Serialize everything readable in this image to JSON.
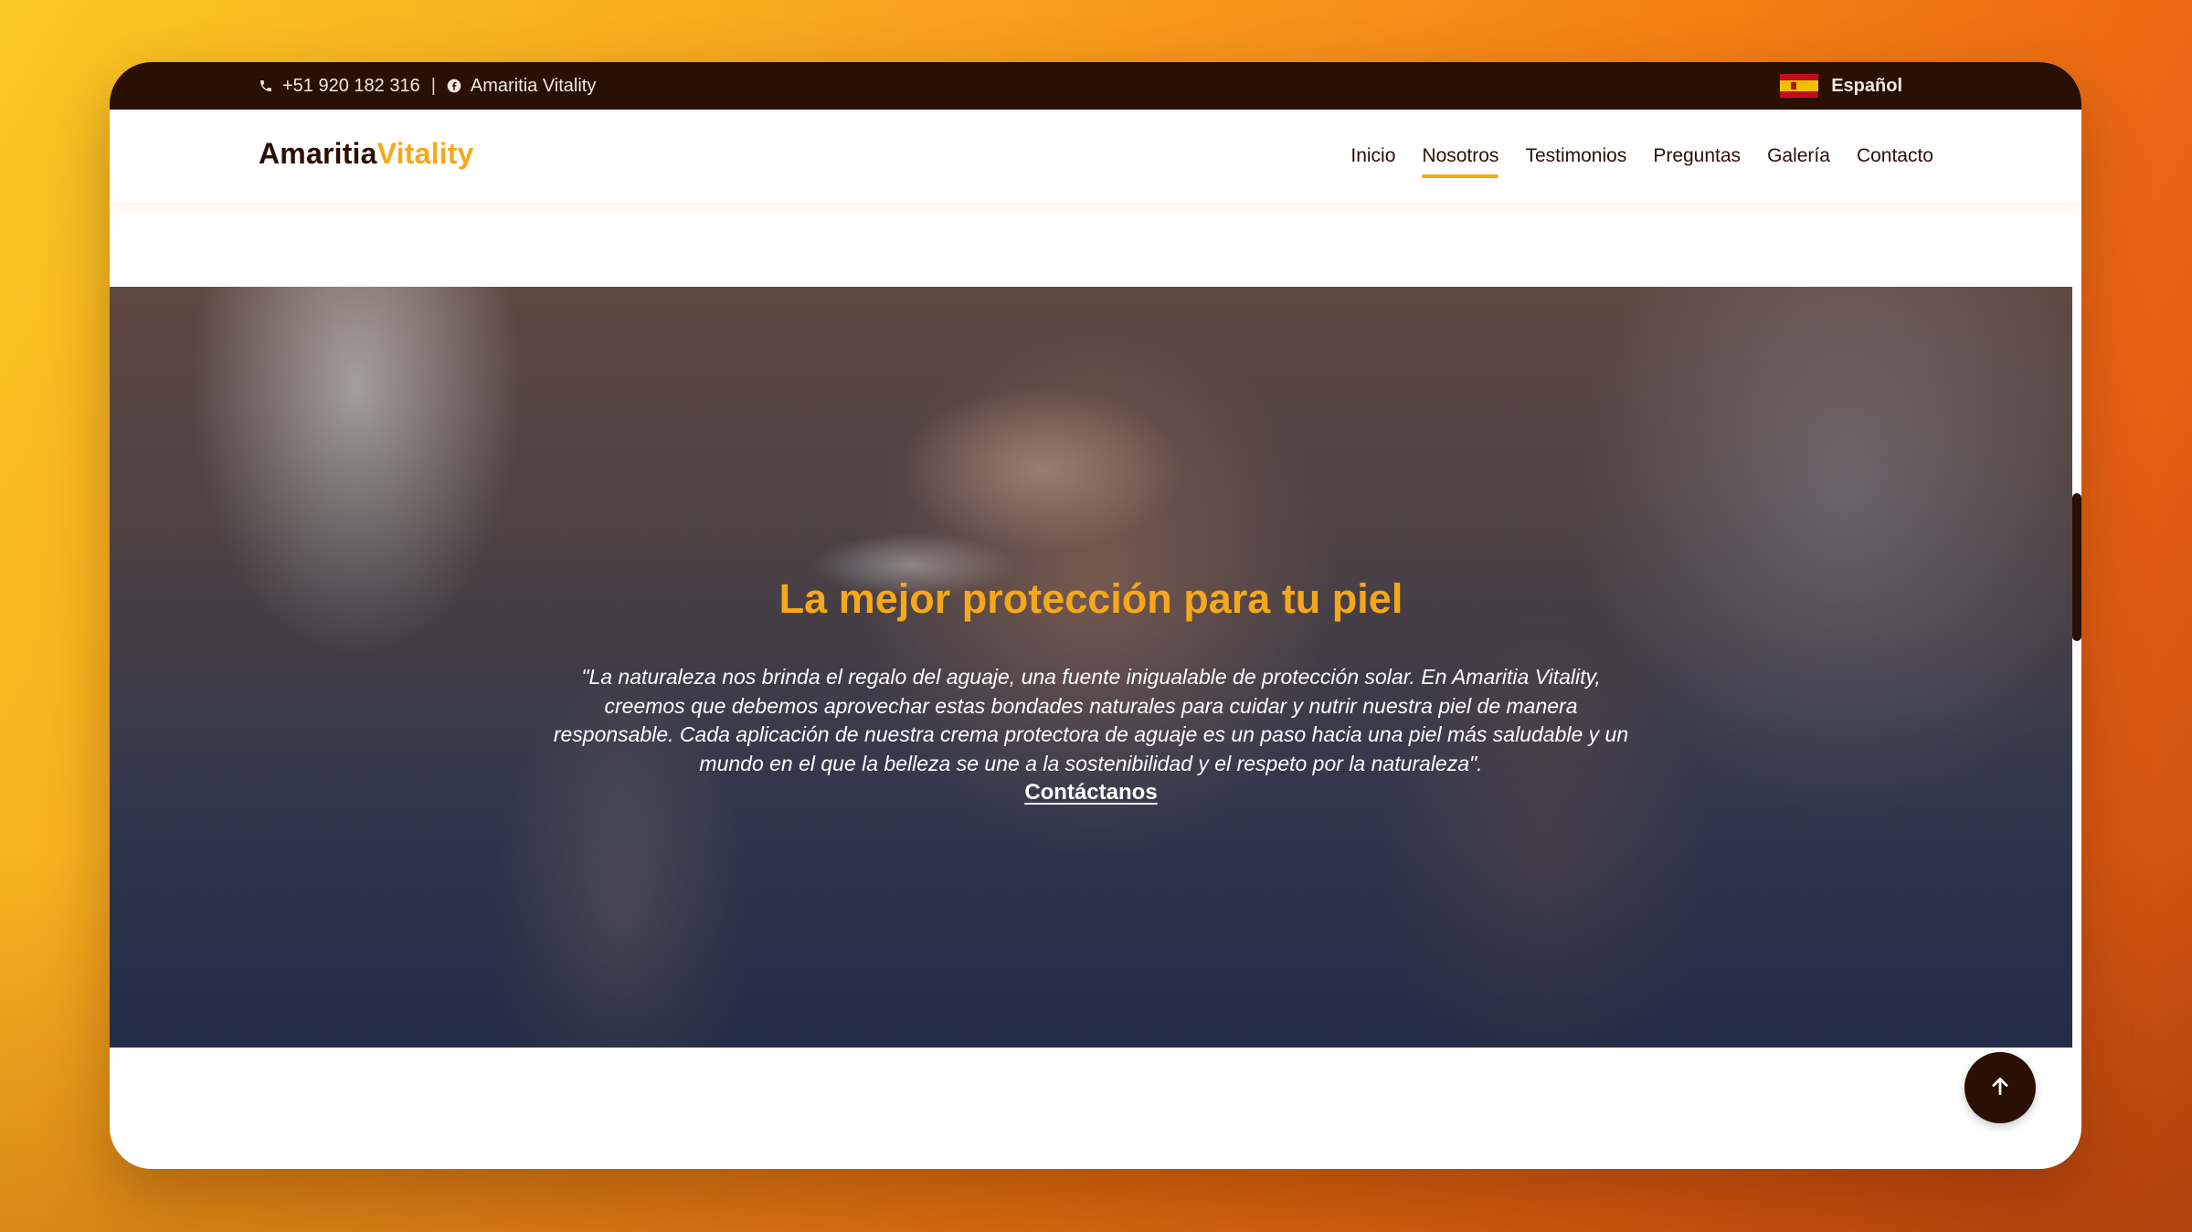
{
  "topbar": {
    "phone": "+51 920 182 316",
    "separator": "|",
    "facebook": "Amaritia Vitality",
    "language": "Español"
  },
  "navbar": {
    "logo_main": "Amaritia",
    "logo_accent": "Vitality",
    "links": [
      "Inicio",
      "Nosotros",
      "Testimonios",
      "Preguntas",
      "Galería",
      "Contacto"
    ],
    "active": "Nosotros"
  },
  "hero": {
    "title": "La mejor protección para tu piel",
    "quote": "\"La naturaleza nos brinda el regalo del aguaje, una fuente inigualable de protección solar. En Amaritia Vitality, creemos que debemos aprovechar estas bondades naturales para cuidar y nutrir nuestra piel de manera responsable. Cada aplicación de nuestra crema protectora de aguaje es un paso hacia una piel más saludable y un mundo en el que la belleza se une a la sostenibilidad y el respeto por la naturaleza\".",
    "cta": "Contáctanos"
  },
  "icons": {
    "phone": "phone-icon",
    "facebook": "facebook-icon",
    "flag": "spain-flag-icon",
    "to_top": "arrow-up-icon"
  },
  "colors": {
    "dark_brown": "#2a0f04",
    "accent_orange": "#f5a81b",
    "white": "#ffffff"
  }
}
